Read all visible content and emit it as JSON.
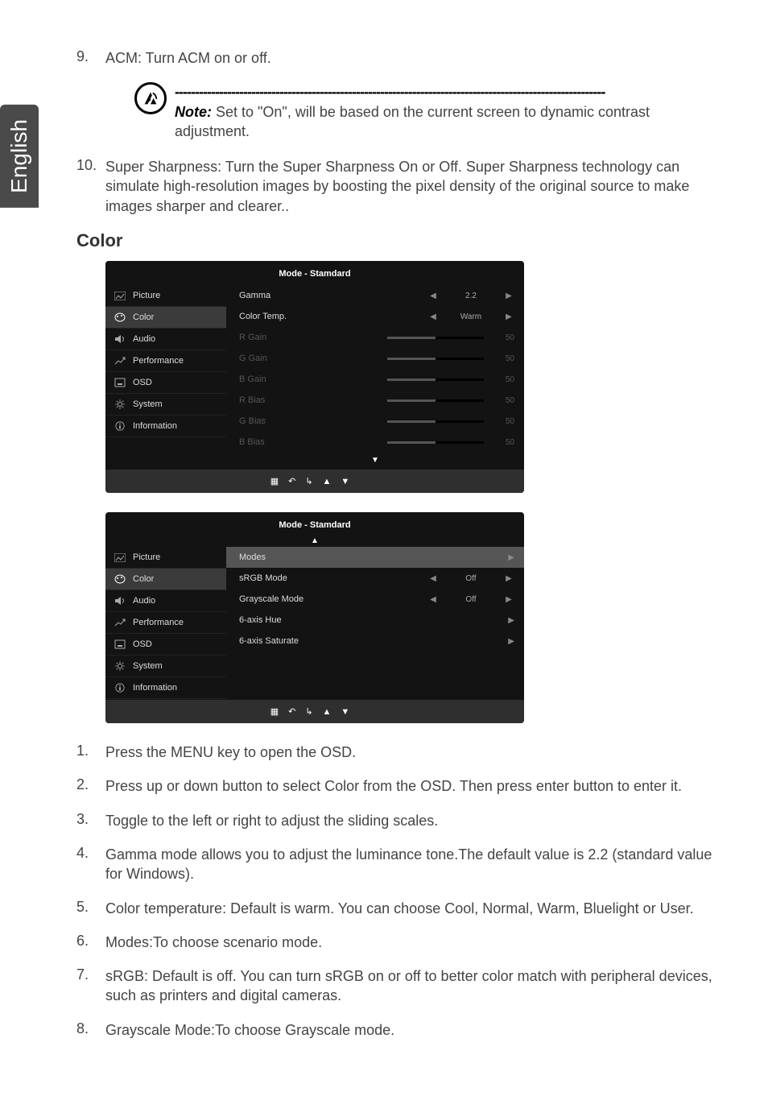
{
  "sidebar": {
    "language": "English"
  },
  "top_list": [
    {
      "num": "9.",
      "text": "ACM: Turn ACM on or off."
    },
    {
      "num": "10.",
      "text": "Super Sharpness: Turn the Super Sharpness On or Off. Super Sharpness technology can simulate high-resolution images by boosting the pixel density of the original source to make images sharper and clearer.."
    }
  ],
  "note": {
    "dashes": "-----------------------------------------------------------------------------------------------------------",
    "label": "Note:",
    "text": " Set to \"On\", will be based on the current screen to dynamic contrast adjustment."
  },
  "section_title": "Color",
  "osd1": {
    "title": "Mode - Stamdard",
    "nav": [
      "Picture",
      "Color",
      "Audio",
      "Performance",
      "OSD",
      "System",
      "Information"
    ],
    "rows": {
      "gamma": {
        "label": "Gamma",
        "value": "2.2"
      },
      "colortemp": {
        "label": "Color Temp.",
        "value": "Warm"
      },
      "rgain": {
        "label": "R Gain",
        "value": "50"
      },
      "ggain": {
        "label": "G Gain",
        "value": "50"
      },
      "bgain": {
        "label": "B Gain",
        "value": "50"
      },
      "rbias": {
        "label": "R Bias",
        "value": "50"
      },
      "gbias": {
        "label": "G Bias",
        "value": "50"
      },
      "bbias": {
        "label": "B Bias",
        "value": "50"
      }
    }
  },
  "osd2": {
    "title": "Mode - Stamdard",
    "nav": [
      "Picture",
      "Color",
      "Audio",
      "Performance",
      "OSD",
      "System",
      "Information"
    ],
    "rows": {
      "modes": {
        "label": "Modes"
      },
      "srgb": {
        "label": "sRGB Mode",
        "value": "Off"
      },
      "grayscale": {
        "label": "Grayscale Mode",
        "value": "Off"
      },
      "hue": {
        "label": "6-axis Hue"
      },
      "saturate": {
        "label": "6-axis Saturate"
      }
    }
  },
  "bottom_list": [
    {
      "num": "1.",
      "text": "Press the MENU key to open the OSD."
    },
    {
      "num": "2.",
      "text": "Press up or down button to select Color from the OSD. Then press enter button to enter it."
    },
    {
      "num": "3.",
      "text": "Toggle to the left or right to adjust the sliding scales."
    },
    {
      "num": "4.",
      "text": "Gamma mode allows you to adjust the luminance tone.The default value is 2.2 (standard value for Windows)."
    },
    {
      "num": "5.",
      "text": "Color temperature: Default is warm. You can choose Cool, Normal, Warm, Bluelight or User."
    },
    {
      "num": "6.",
      "text": "Modes:To choose scenario mode."
    },
    {
      "num": "7.",
      "text": "sRGB: Default is off. You can turn sRGB on or off to better color match with peripheral devices, such as printers and digital cameras."
    },
    {
      "num": "8.",
      "text": "Grayscale Mode:To choose Grayscale mode."
    }
  ]
}
